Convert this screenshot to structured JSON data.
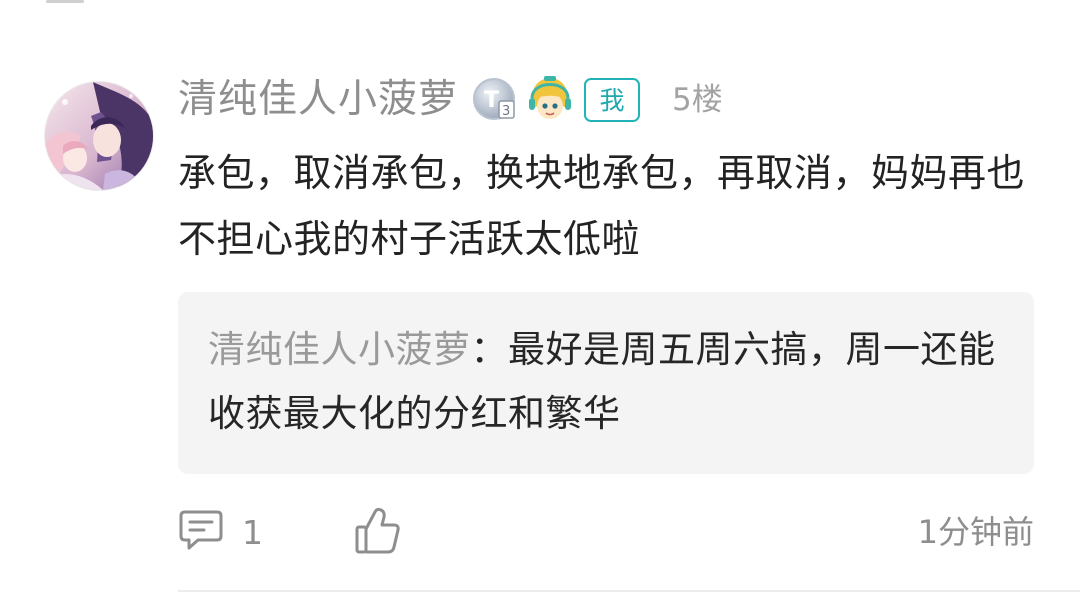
{
  "comment": {
    "author": "清纯佳人小菠萝",
    "level_badge": "T3",
    "self_tag": "我",
    "floor": "5楼",
    "content": "承包，取消承包，换块地承包，再取消，妈妈再也不担心我的村子活跃太低啦",
    "quote": {
      "author": "清纯佳人小菠萝",
      "separator": "：",
      "text": "最好是周五周六搞，周一还能收获最大化的分红和繁华"
    },
    "reply_count": "1",
    "timestamp": "1分钟前"
  },
  "icons": {
    "avatar": "anime-avatar",
    "level": "level-badge-icon",
    "mascot": "mascot-badge-icon",
    "reply": "comment-icon",
    "like": "thumbs-up-icon"
  },
  "colors": {
    "accent": "#22b3b8",
    "secondary_text": "#8e8e8e",
    "quote_bg": "#f4f4f4"
  }
}
